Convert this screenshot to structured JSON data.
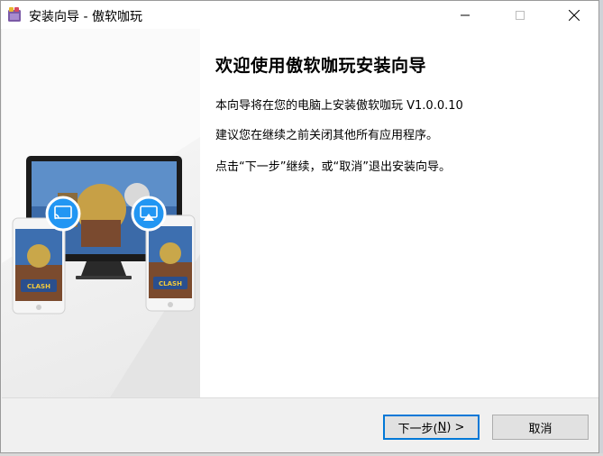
{
  "window": {
    "title": "安装向导 - 傲软咖玩",
    "min_icon": "minimize-icon",
    "max_icon": "maximize-icon",
    "close_icon": "close-icon"
  },
  "side_panel": {
    "illustration": "devices-illustration",
    "badge_left_icon": "cast-icon",
    "badge_right_icon": "airplay-icon",
    "phone_left_logo": "CLASH ROYALE",
    "phone_right_logo": "CLASH ROYALE"
  },
  "welcome": {
    "heading": "欢迎使用傲软咖玩安装向导",
    "line1": "本向导将在您的电脑上安装傲软咖玩 V1.0.0.10",
    "line2": "建议您在继续之前关闭其他所有应用程序。",
    "line3": "点击“下一步”继续，或“取消”退出安装向导。"
  },
  "buttons": {
    "next_prefix": "下一步(",
    "next_key": "N",
    "next_suffix": ") >",
    "cancel": "取消"
  },
  "colors": {
    "accent": "#0078d7",
    "badge": "#2196f3"
  }
}
